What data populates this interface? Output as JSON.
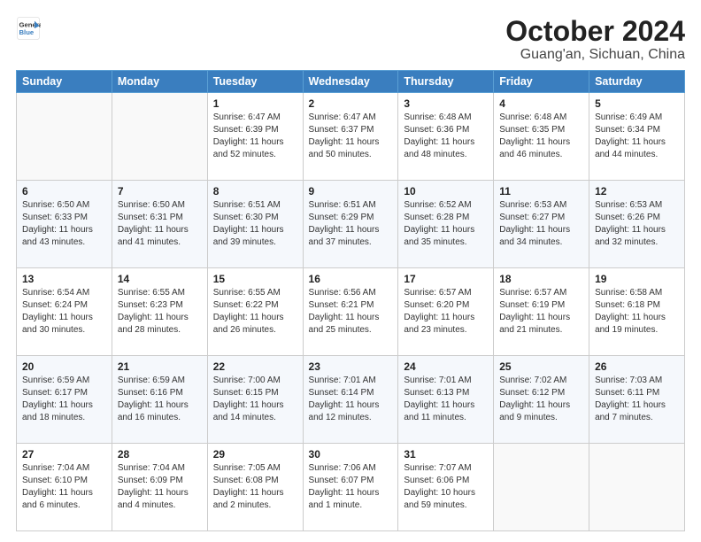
{
  "logo": {
    "line1": "General",
    "line2": "Blue"
  },
  "title": "October 2024",
  "subtitle": "Guang'an, Sichuan, China",
  "days": [
    "Sunday",
    "Monday",
    "Tuesday",
    "Wednesday",
    "Thursday",
    "Friday",
    "Saturday"
  ],
  "weeks": [
    [
      {
        "date": "",
        "sunrise": "",
        "sunset": "",
        "daylight": ""
      },
      {
        "date": "",
        "sunrise": "",
        "sunset": "",
        "daylight": ""
      },
      {
        "date": "1",
        "sunrise": "Sunrise: 6:47 AM",
        "sunset": "Sunset: 6:39 PM",
        "daylight": "Daylight: 11 hours and 52 minutes."
      },
      {
        "date": "2",
        "sunrise": "Sunrise: 6:47 AM",
        "sunset": "Sunset: 6:37 PM",
        "daylight": "Daylight: 11 hours and 50 minutes."
      },
      {
        "date": "3",
        "sunrise": "Sunrise: 6:48 AM",
        "sunset": "Sunset: 6:36 PM",
        "daylight": "Daylight: 11 hours and 48 minutes."
      },
      {
        "date": "4",
        "sunrise": "Sunrise: 6:48 AM",
        "sunset": "Sunset: 6:35 PM",
        "daylight": "Daylight: 11 hours and 46 minutes."
      },
      {
        "date": "5",
        "sunrise": "Sunrise: 6:49 AM",
        "sunset": "Sunset: 6:34 PM",
        "daylight": "Daylight: 11 hours and 44 minutes."
      }
    ],
    [
      {
        "date": "6",
        "sunrise": "Sunrise: 6:50 AM",
        "sunset": "Sunset: 6:33 PM",
        "daylight": "Daylight: 11 hours and 43 minutes."
      },
      {
        "date": "7",
        "sunrise": "Sunrise: 6:50 AM",
        "sunset": "Sunset: 6:31 PM",
        "daylight": "Daylight: 11 hours and 41 minutes."
      },
      {
        "date": "8",
        "sunrise": "Sunrise: 6:51 AM",
        "sunset": "Sunset: 6:30 PM",
        "daylight": "Daylight: 11 hours and 39 minutes."
      },
      {
        "date": "9",
        "sunrise": "Sunrise: 6:51 AM",
        "sunset": "Sunset: 6:29 PM",
        "daylight": "Daylight: 11 hours and 37 minutes."
      },
      {
        "date": "10",
        "sunrise": "Sunrise: 6:52 AM",
        "sunset": "Sunset: 6:28 PM",
        "daylight": "Daylight: 11 hours and 35 minutes."
      },
      {
        "date": "11",
        "sunrise": "Sunrise: 6:53 AM",
        "sunset": "Sunset: 6:27 PM",
        "daylight": "Daylight: 11 hours and 34 minutes."
      },
      {
        "date": "12",
        "sunrise": "Sunrise: 6:53 AM",
        "sunset": "Sunset: 6:26 PM",
        "daylight": "Daylight: 11 hours and 32 minutes."
      }
    ],
    [
      {
        "date": "13",
        "sunrise": "Sunrise: 6:54 AM",
        "sunset": "Sunset: 6:24 PM",
        "daylight": "Daylight: 11 hours and 30 minutes."
      },
      {
        "date": "14",
        "sunrise": "Sunrise: 6:55 AM",
        "sunset": "Sunset: 6:23 PM",
        "daylight": "Daylight: 11 hours and 28 minutes."
      },
      {
        "date": "15",
        "sunrise": "Sunrise: 6:55 AM",
        "sunset": "Sunset: 6:22 PM",
        "daylight": "Daylight: 11 hours and 26 minutes."
      },
      {
        "date": "16",
        "sunrise": "Sunrise: 6:56 AM",
        "sunset": "Sunset: 6:21 PM",
        "daylight": "Daylight: 11 hours and 25 minutes."
      },
      {
        "date": "17",
        "sunrise": "Sunrise: 6:57 AM",
        "sunset": "Sunset: 6:20 PM",
        "daylight": "Daylight: 11 hours and 23 minutes."
      },
      {
        "date": "18",
        "sunrise": "Sunrise: 6:57 AM",
        "sunset": "Sunset: 6:19 PM",
        "daylight": "Daylight: 11 hours and 21 minutes."
      },
      {
        "date": "19",
        "sunrise": "Sunrise: 6:58 AM",
        "sunset": "Sunset: 6:18 PM",
        "daylight": "Daylight: 11 hours and 19 minutes."
      }
    ],
    [
      {
        "date": "20",
        "sunrise": "Sunrise: 6:59 AM",
        "sunset": "Sunset: 6:17 PM",
        "daylight": "Daylight: 11 hours and 18 minutes."
      },
      {
        "date": "21",
        "sunrise": "Sunrise: 6:59 AM",
        "sunset": "Sunset: 6:16 PM",
        "daylight": "Daylight: 11 hours and 16 minutes."
      },
      {
        "date": "22",
        "sunrise": "Sunrise: 7:00 AM",
        "sunset": "Sunset: 6:15 PM",
        "daylight": "Daylight: 11 hours and 14 minutes."
      },
      {
        "date": "23",
        "sunrise": "Sunrise: 7:01 AM",
        "sunset": "Sunset: 6:14 PM",
        "daylight": "Daylight: 11 hours and 12 minutes."
      },
      {
        "date": "24",
        "sunrise": "Sunrise: 7:01 AM",
        "sunset": "Sunset: 6:13 PM",
        "daylight": "Daylight: 11 hours and 11 minutes."
      },
      {
        "date": "25",
        "sunrise": "Sunrise: 7:02 AM",
        "sunset": "Sunset: 6:12 PM",
        "daylight": "Daylight: 11 hours and 9 minutes."
      },
      {
        "date": "26",
        "sunrise": "Sunrise: 7:03 AM",
        "sunset": "Sunset: 6:11 PM",
        "daylight": "Daylight: 11 hours and 7 minutes."
      }
    ],
    [
      {
        "date": "27",
        "sunrise": "Sunrise: 7:04 AM",
        "sunset": "Sunset: 6:10 PM",
        "daylight": "Daylight: 11 hours and 6 minutes."
      },
      {
        "date": "28",
        "sunrise": "Sunrise: 7:04 AM",
        "sunset": "Sunset: 6:09 PM",
        "daylight": "Daylight: 11 hours and 4 minutes."
      },
      {
        "date": "29",
        "sunrise": "Sunrise: 7:05 AM",
        "sunset": "Sunset: 6:08 PM",
        "daylight": "Daylight: 11 hours and 2 minutes."
      },
      {
        "date": "30",
        "sunrise": "Sunrise: 7:06 AM",
        "sunset": "Sunset: 6:07 PM",
        "daylight": "Daylight: 11 hours and 1 minute."
      },
      {
        "date": "31",
        "sunrise": "Sunrise: 7:07 AM",
        "sunset": "Sunset: 6:06 PM",
        "daylight": "Daylight: 10 hours and 59 minutes."
      },
      {
        "date": "",
        "sunrise": "",
        "sunset": "",
        "daylight": ""
      },
      {
        "date": "",
        "sunrise": "",
        "sunset": "",
        "daylight": ""
      }
    ]
  ]
}
